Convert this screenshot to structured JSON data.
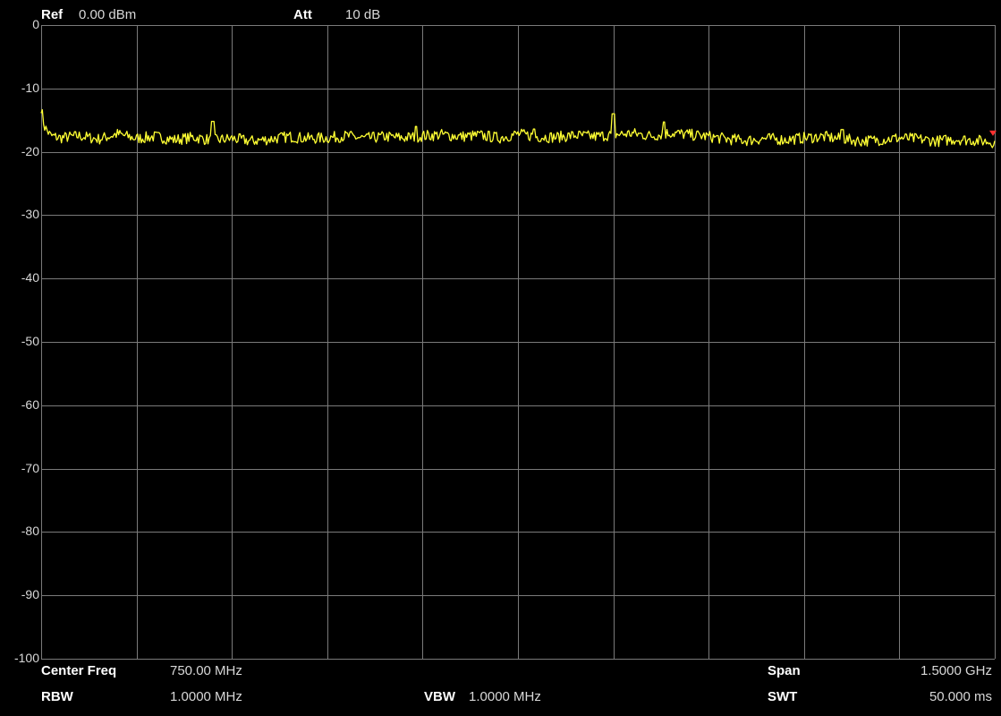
{
  "header": {
    "ref_label": "Ref",
    "ref_value": "0.00 dBm",
    "att_label": "Att",
    "att_value": "10 dB"
  },
  "footer": {
    "center_freq_label": "Center Freq",
    "center_freq_value": "750.00 MHz",
    "span_label": "Span",
    "span_value": "1.5000 GHz",
    "rbw_label": "RBW",
    "rbw_value": "1.0000 MHz",
    "vbw_label": "VBW",
    "vbw_value": "1.0000 MHz",
    "swt_label": "SWT",
    "swt_value": "50.000 ms"
  },
  "colors": {
    "background": "#000000",
    "grid": "#7a7a7a",
    "trace": "#ffff33",
    "marker": "#ff3030",
    "text": "#e6e6e6"
  },
  "chart_data": {
    "type": "line",
    "title": "",
    "xlabel": "",
    "ylabel": "",
    "xlim": [
      0,
      1500
    ],
    "x_unit": "MHz",
    "ylim": [
      -100,
      0
    ],
    "y_unit": "dBm",
    "yticks": [
      "0",
      "-10",
      "-20",
      "-30",
      "-40",
      "-50",
      "-60",
      "-70",
      "-80",
      "-90",
      "-100"
    ],
    "x_divisions": 10,
    "y_divisions": 10,
    "grid": true,
    "series": [
      {
        "values_x_mhz": [
          0,
          5,
          15,
          30,
          60,
          90,
          120,
          150,
          180,
          210,
          240,
          270,
          300,
          330,
          360,
          390,
          420,
          450,
          480,
          510,
          540,
          570,
          600,
          630,
          660,
          690,
          720,
          750,
          780,
          810,
          840,
          870,
          900,
          930,
          960,
          990,
          1020,
          1050,
          1080,
          1110,
          1140,
          1170,
          1200,
          1230,
          1260,
          1290,
          1320,
          1350,
          1380,
          1410,
          1440,
          1470,
          1500
        ],
        "values_dbm": [
          -13,
          -16,
          -17.5,
          -17.8,
          -17.5,
          -18.0,
          -17.2,
          -17.9,
          -17.6,
          -18.1,
          -17.7,
          -18.2,
          -17.9,
          -18.3,
          -18.0,
          -17.6,
          -17.9,
          -17.8,
          -17.5,
          -17.9,
          -17.6,
          -17.8,
          -17.5,
          -17.3,
          -17.6,
          -17.4,
          -17.8,
          -17.2,
          -17.6,
          -17.7,
          -17.4,
          -17.6,
          -17.3,
          -17.1,
          -17.5,
          -17.0,
          -17.3,
          -17.6,
          -18.0,
          -18.2,
          -17.9,
          -18.1,
          -17.8,
          -17.6,
          -18.0,
          -18.3,
          -18.1,
          -17.8,
          -18.0,
          -18.3,
          -18.0,
          -18.2,
          -18.5
        ]
      }
    ],
    "peaks": [
      {
        "x_mhz": 270,
        "y_dbm": -15.2
      },
      {
        "x_mhz": 590,
        "y_dbm": -16.0
      },
      {
        "x_mhz": 775,
        "y_dbm": -16.4
      },
      {
        "x_mhz": 900,
        "y_dbm": -14.0
      },
      {
        "x_mhz": 980,
        "y_dbm": -15.3
      },
      {
        "x_mhz": 1260,
        "y_dbm": -16.5
      }
    ]
  }
}
